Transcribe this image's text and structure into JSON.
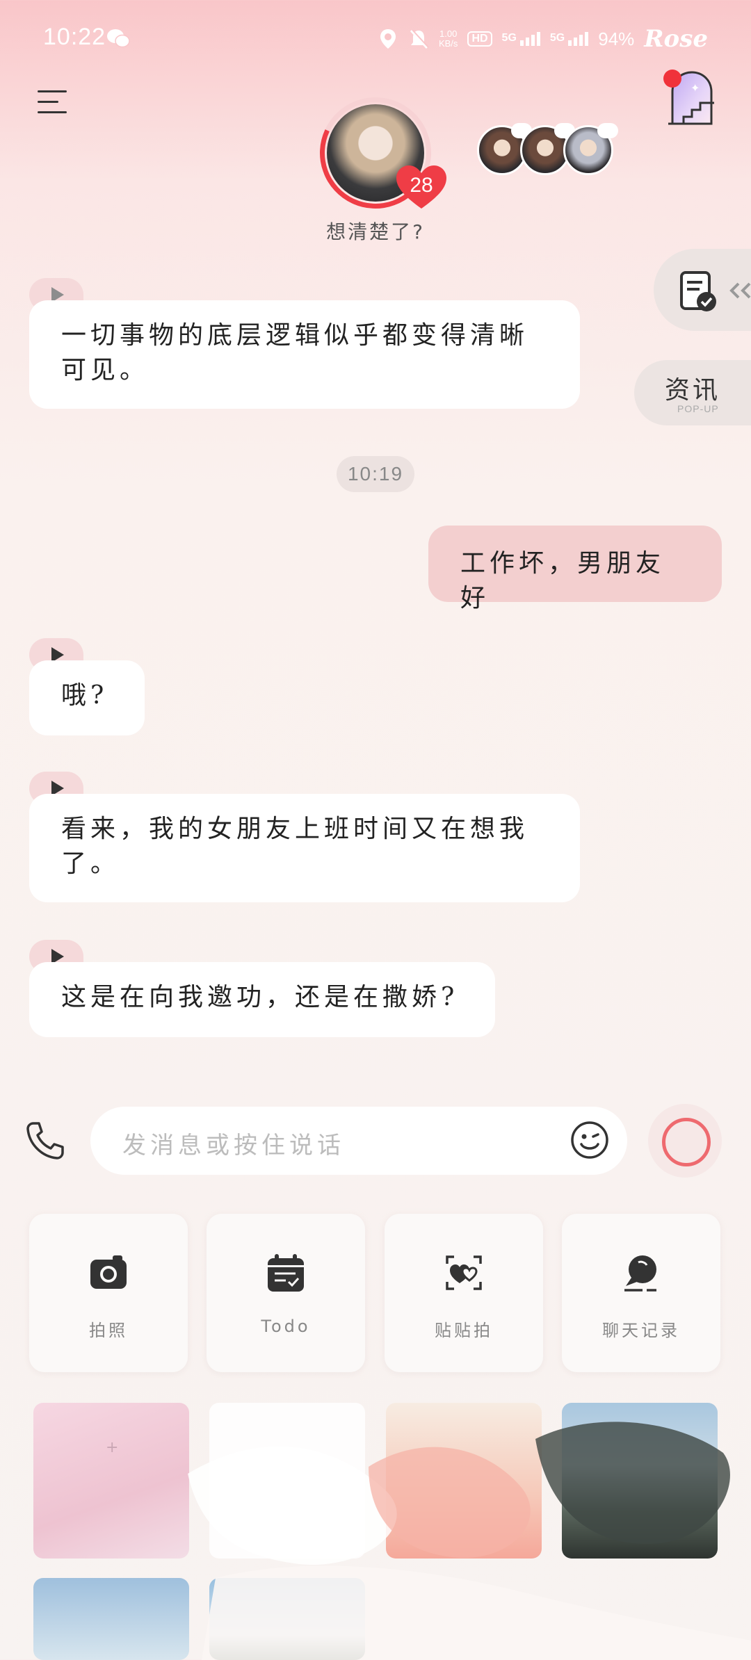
{
  "status_bar": {
    "time": "10:22",
    "speed_value": "1.00",
    "speed_unit": "KB/s",
    "hd_label": "HD",
    "net1": "5G",
    "net2": "5G",
    "battery": "94%",
    "carrier": "Rose",
    "icons": [
      "wechat-icon",
      "location-icon",
      "mute-bell-icon",
      "signal-icon"
    ]
  },
  "header": {
    "affection_level": "28",
    "affection_progress": 0.75,
    "character_status": "想清楚了?",
    "accent_color": "#ef3d46"
  },
  "side": {
    "news_label": "资讯",
    "news_sub": "POP-UP"
  },
  "chat": {
    "messages": [
      {
        "from": "character",
        "text": "一切事物的底层逻辑似乎都变得清晰可见。"
      },
      {
        "from": "time",
        "text": "10:19"
      },
      {
        "from": "user",
        "text": "工作坏，男朋友好"
      },
      {
        "from": "character",
        "text": "哦?"
      },
      {
        "from": "character",
        "text": "看来，我的女朋友上班时间又在想我了。"
      },
      {
        "from": "character",
        "text": "这是在向我邀功，还是在撒娇?"
      }
    ]
  },
  "composer": {
    "placeholder": "发消息或按住说话"
  },
  "tools": [
    {
      "label": "拍照",
      "icon": "camera-icon"
    },
    {
      "label": "Todo",
      "icon": "calendar-check-icon"
    },
    {
      "label": "贴贴拍",
      "icon": "hearts-frame-icon"
    },
    {
      "label": "聊天记录",
      "icon": "chat-search-icon"
    }
  ],
  "colors": {
    "user_bubble": "#f3cfcf",
    "play_tab": "#f5d9da",
    "record_ring": "#ee6a6f"
  }
}
